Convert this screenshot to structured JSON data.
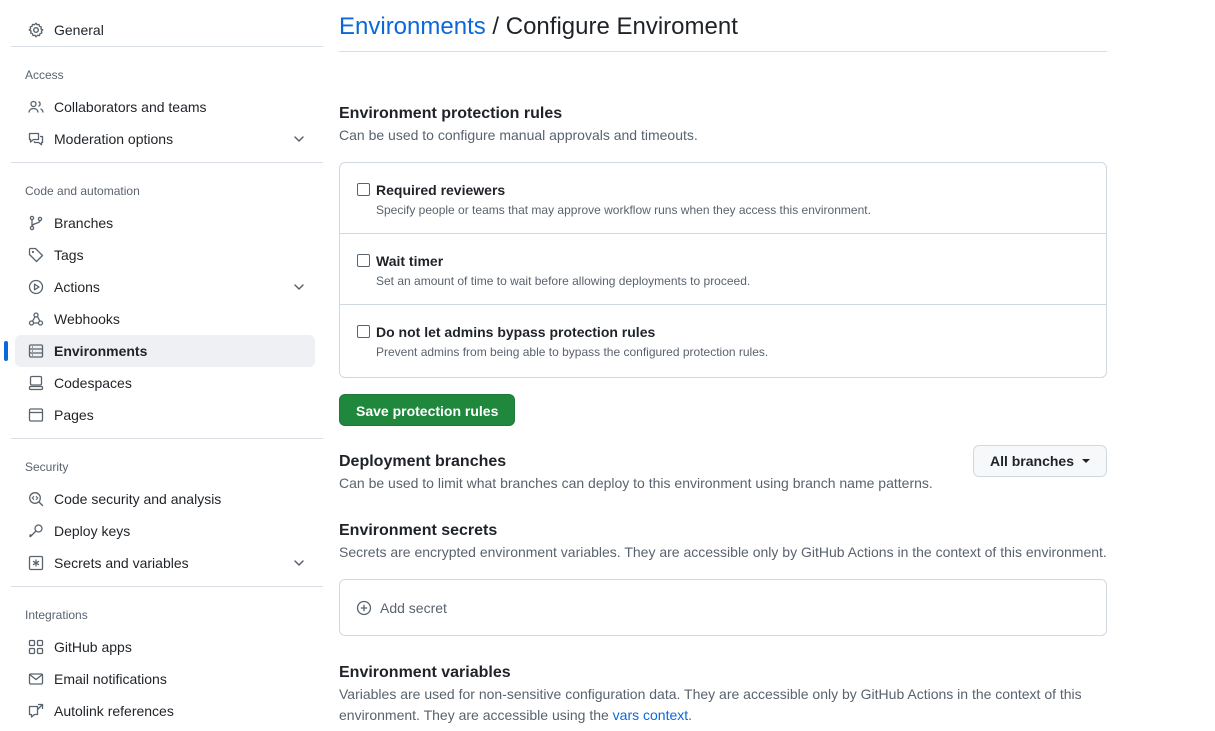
{
  "sidebar": {
    "general": "General",
    "groups": [
      {
        "title": "Access",
        "items": [
          {
            "label": "Collaborators and teams",
            "icon": "people-icon"
          },
          {
            "label": "Moderation options",
            "icon": "comment-discussion-icon",
            "expandable": true
          }
        ]
      },
      {
        "title": "Code and automation",
        "items": [
          {
            "label": "Branches",
            "icon": "git-branch-icon"
          },
          {
            "label": "Tags",
            "icon": "tag-icon"
          },
          {
            "label": "Actions",
            "icon": "play-icon",
            "expandable": true
          },
          {
            "label": "Webhooks",
            "icon": "webhook-icon"
          },
          {
            "label": "Environments",
            "icon": "server-icon",
            "active": true
          },
          {
            "label": "Codespaces",
            "icon": "codespaces-icon"
          },
          {
            "label": "Pages",
            "icon": "browser-icon"
          }
        ]
      },
      {
        "title": "Security",
        "items": [
          {
            "label": "Code security and analysis",
            "icon": "codescan-icon"
          },
          {
            "label": "Deploy keys",
            "icon": "key-icon"
          },
          {
            "label": "Secrets and variables",
            "icon": "key-asterisk-icon",
            "expandable": true
          }
        ]
      },
      {
        "title": "Integrations",
        "items": [
          {
            "label": "GitHub apps",
            "icon": "apps-icon"
          },
          {
            "label": "Email notifications",
            "icon": "mail-icon"
          },
          {
            "label": "Autolink references",
            "icon": "cross-reference-icon"
          }
        ]
      }
    ]
  },
  "header": {
    "breadcrumb_link": "Environments",
    "separator": " / ",
    "title": "Configure Enviroment"
  },
  "protection": {
    "title": "Environment protection rules",
    "desc": "Can be used to configure manual approvals and timeouts.",
    "rules": [
      {
        "label": "Required reviewers",
        "desc": "Specify people or teams that may approve workflow runs when they access this environment.",
        "checked": false
      },
      {
        "label": "Wait timer",
        "desc": "Set an amount of time to wait before allowing deployments to proceed.",
        "checked": false
      },
      {
        "label": "Do not let admins bypass protection rules",
        "desc": "Prevent admins from being able to bypass the configured protection rules.",
        "checked": false
      }
    ],
    "save_label": "Save protection rules"
  },
  "deployment": {
    "title": "Deployment branches",
    "desc": "Can be used to limit what branches can deploy to this environment using branch name patterns.",
    "select_value": "All branches"
  },
  "secrets": {
    "title": "Environment secrets",
    "desc": "Secrets are encrypted environment variables. They are accessible only by GitHub Actions in the context of this environment.",
    "add_label": "Add secret"
  },
  "variables": {
    "title": "Environment variables",
    "desc_before": "Variables are used for non-sensitive configuration data. They are accessible only by GitHub Actions in the context of this environment. They are accessible using the ",
    "desc_link": "vars context",
    "desc_after": "."
  },
  "colors": {
    "accent": "#0969da",
    "primary_button": "#1f883d",
    "muted_text": "#59636e"
  }
}
